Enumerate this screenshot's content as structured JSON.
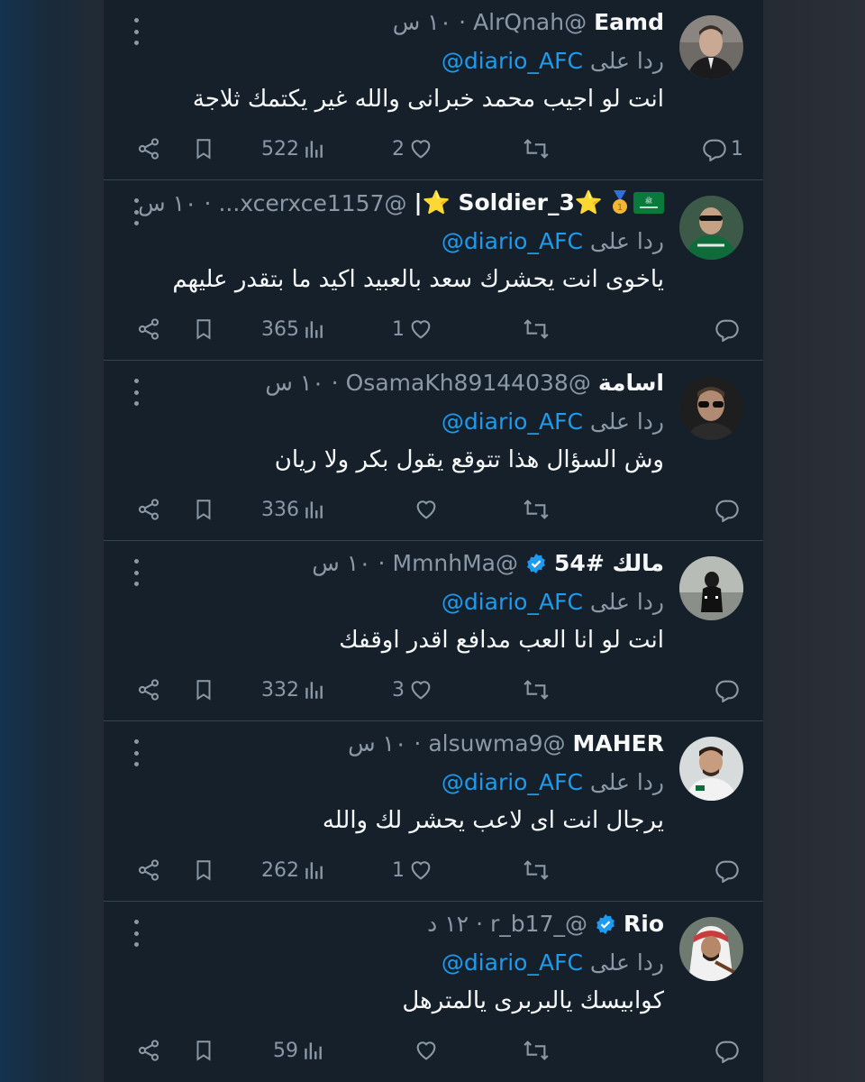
{
  "colors": {
    "background": "#15202b",
    "text": "#f7f9f9",
    "muted": "#8b98a5",
    "accent": "#1d9bf0",
    "divider": "#38444d"
  },
  "tweets": [
    {
      "display_name": "Eamd",
      "handle": "@AlrQnah",
      "time": "١٠ س",
      "verified": false,
      "reply_label": "ردا على",
      "reply_to": "@diario_AFC",
      "text": "انت لو اجيب محمد خبرانى والله غير يكتمك ثلاجة",
      "replies": "1",
      "retweets": "",
      "likes": "2",
      "views": "522",
      "avatar_icon": "suited-man-avatar"
    },
    {
      "display_name": "⭐Soldier_3 ⭐|",
      "handle": "@xcerxce1157...",
      "time": "١٠ س",
      "verified": false,
      "name_emojis": [
        "flag-icon",
        "medal-icon"
      ],
      "reply_label": "ردا على",
      "reply_to": "@diario_AFC",
      "text": "ياخوى انت يحشرك سعد بالعبيد اكيد ما بتقدر عليهم",
      "replies": "",
      "retweets": "",
      "likes": "1",
      "views": "365",
      "avatar_icon": "green-jersey-avatar"
    },
    {
      "display_name": "اسامة",
      "handle": "@OsamaKh89144038",
      "time": "١٠ س",
      "verified": false,
      "reply_label": "ردا على",
      "reply_to": "@diario_AFC",
      "text": "وش السؤال هذا تتوقع يقول بكر ولا ريان",
      "replies": "",
      "retweets": "",
      "likes": "",
      "views": "336",
      "avatar_icon": "sunglasses-man-avatar"
    },
    {
      "display_name": "مالك #54",
      "handle": "@MmnhMa",
      "time": "١٠ س",
      "verified": true,
      "reply_label": "ردا على",
      "reply_to": "@diario_AFC",
      "text": "انت لو انا العب مدافع اقدر اوقفك",
      "replies": "",
      "retweets": "",
      "likes": "3",
      "views": "332",
      "avatar_icon": "hooded-figure-avatar"
    },
    {
      "display_name": "MAHER",
      "handle": "@alsuwma9",
      "time": "١٠ س",
      "verified": false,
      "reply_label": "ردا على",
      "reply_to": "@diario_AFC",
      "text": "يرجال انت اى لاعب يحشر لك والله",
      "replies": "",
      "retweets": "",
      "likes": "1",
      "views": "262",
      "avatar_icon": "player-avatar"
    },
    {
      "display_name": "Rio",
      "handle": "@_r_b17",
      "time": "١٢ د",
      "verified": true,
      "reply_label": "ردا على",
      "reply_to": "@diario_AFC",
      "text": "كوابيسك يالبربرى يالمترهل",
      "replies": "",
      "retweets": "",
      "likes": "",
      "views": "59",
      "avatar_icon": "shemagh-man-avatar"
    }
  ]
}
